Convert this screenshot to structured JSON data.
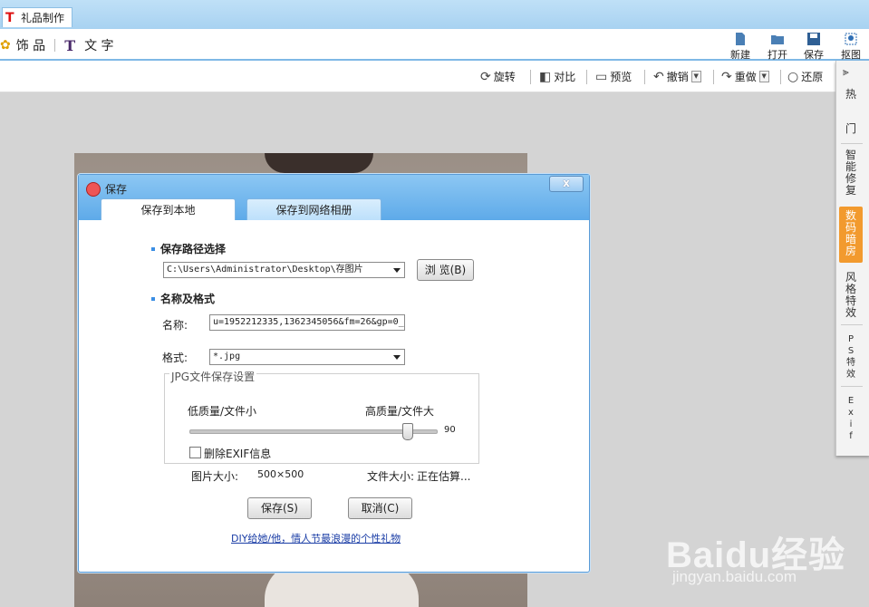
{
  "app": {
    "tab_title": "礼品制作"
  },
  "toolbar": {
    "left_items": [
      {
        "label": "饰 品",
        "icon": "flower-icon"
      },
      {
        "label": "文 字",
        "icon": "text-T-icon"
      }
    ],
    "buttons": [
      {
        "label": "新建",
        "icon": "new-file-icon"
      },
      {
        "label": "打开",
        "icon": "folder-open-icon"
      },
      {
        "label": "保存",
        "icon": "save-disk-icon"
      },
      {
        "label": "抠图",
        "icon": "cutout-icon"
      }
    ]
  },
  "subtoolbar": {
    "rotate": "旋转",
    "compare": "对比",
    "preview": "预览",
    "undo": "撤销",
    "redo": "重做",
    "restore": "还原"
  },
  "sidepanel": {
    "items": [
      "热",
      "门",
      "智\n能\n修\n复",
      "数\n码\n暗\n房",
      "风\n格\n特\n效",
      "P\nS\n特\n效",
      "E\nx\ni\nf"
    ],
    "active_index": 3
  },
  "dialog": {
    "title": "保存",
    "close": "x",
    "tabs": [
      "保存到本地",
      "保存到网络相册"
    ],
    "active_tab": 0,
    "path_section": "保存路径选择",
    "path_value": "C:\\Users\\Administrator\\Desktop\\存图片",
    "browse_button": "浏 览(B)",
    "name_section": "名称及格式",
    "name_label": "名称:",
    "name_value": "u=1952212335,1362345056&fm=26&gp=0_",
    "format_label": "格式:",
    "format_value": "*.jpg",
    "jpg_group_title": "JPG文件保存设置",
    "low_quality": "低质量/文件小",
    "high_quality": "高质量/文件大",
    "quality_value": "90",
    "quality_fraction": 0.9,
    "strip_exif_label": "删除EXIF信息",
    "strip_exif_checked": false,
    "image_size_label": "图片大小:",
    "image_size_value": "500×500",
    "file_size_label": "文件大小:",
    "file_size_value": "正在估算...",
    "save_button": "保存(S)",
    "cancel_button": "取消(C)",
    "promo_link": "DIY给她/他，情人节最浪漫的个性礼物"
  },
  "watermark": {
    "brand": "Baidu经验",
    "url": "jingyan.baidu.com"
  }
}
